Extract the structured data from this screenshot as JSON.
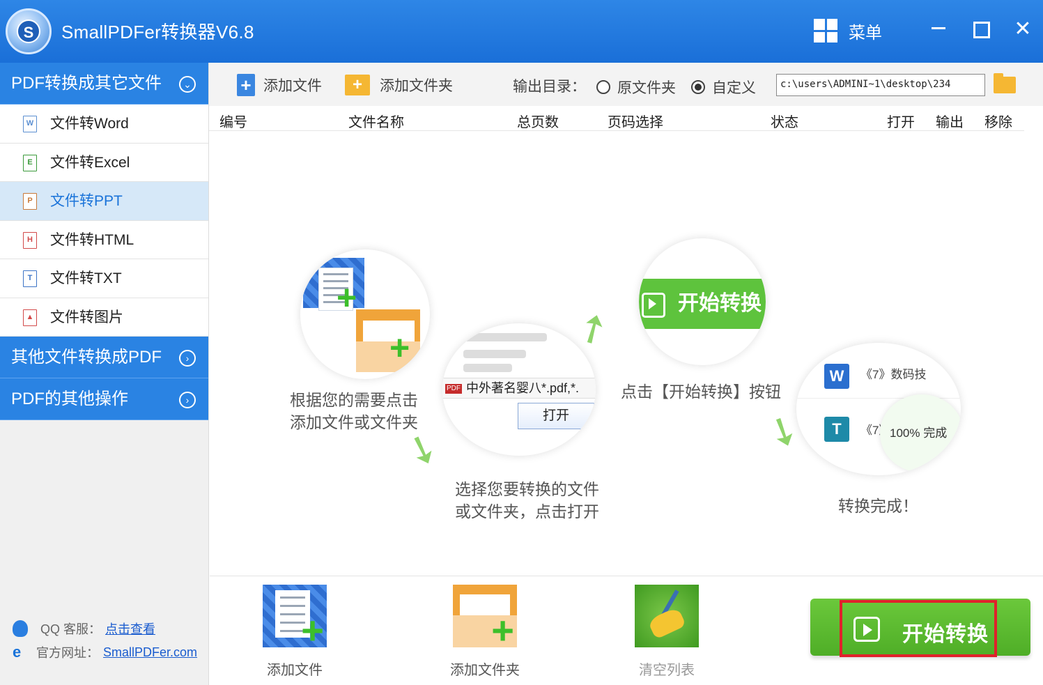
{
  "app": {
    "title": "SmallPDFer转换器V6.8",
    "menu_label": "菜单",
    "logo_letter": "S"
  },
  "window": {
    "close_glyph": "✕"
  },
  "sidebar": {
    "section1": "PDF转换成其它文件",
    "items": [
      {
        "label": "文件转Word",
        "icon": "W"
      },
      {
        "label": "文件转Excel",
        "icon": "E"
      },
      {
        "label": "文件转PPT",
        "icon": "P"
      },
      {
        "label": "文件转HTML",
        "icon": "H"
      },
      {
        "label": "文件转TXT",
        "icon": "T"
      },
      {
        "label": "文件转图片",
        "icon": "▲"
      }
    ],
    "section2": "其他文件转换成PDF",
    "section3": "PDF的其他操作",
    "footer": {
      "qq_label": "QQ 客服：",
      "qq_link": "点击查看",
      "site_label": "官方网址：",
      "site_link": "SmallPDFer.com"
    }
  },
  "toolbar": {
    "add_file": "添加文件",
    "add_folder": "添加文件夹",
    "output_label": "输出目录：",
    "radio_original": "原文件夹",
    "radio_custom": "自定义",
    "output_path": "c:\\users\\ADMINI~1\\desktop\\234"
  },
  "table": {
    "columns": [
      "编号",
      "文件名称",
      "总页数",
      "页码选择",
      "状态",
      "打开",
      "输出",
      "移除"
    ]
  },
  "illustration": {
    "step1": "根据您的需要点击\n添加文件或文件夹",
    "step2": "选择您要转换的文件\n或文件夹，点击打开",
    "step3": "点击【开始转换】按钮",
    "step4": "转换完成！",
    "dialog_file": "中外著名婴八*.pdf,*.",
    "dialog_open": "打开",
    "start_btn_demo": "开始转换",
    "result_row1": "《7》数码技",
    "result_row2": "《7》",
    "result_done": "100%  完成"
  },
  "bottom": {
    "add_file": "添加文件",
    "add_folder": "添加文件夹",
    "clear_list": "清空列表",
    "start": "开始转换"
  }
}
